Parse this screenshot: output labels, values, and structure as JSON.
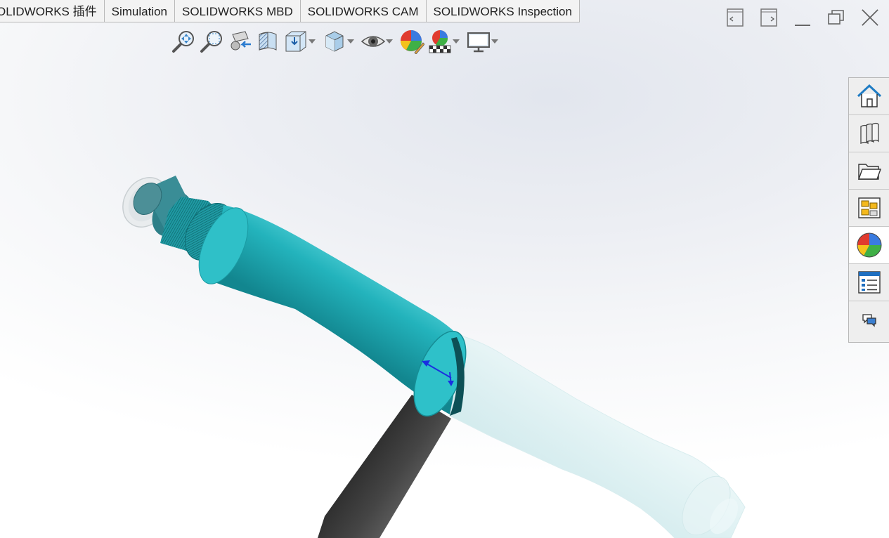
{
  "command_tabs": [
    {
      "label": "OLIDWORKS 插件"
    },
    {
      "label": "Simulation"
    },
    {
      "label": "SOLIDWORKS MBD"
    },
    {
      "label": "SOLIDWORKS CAM"
    },
    {
      "label": "SOLIDWORKS Inspection"
    }
  ],
  "window_controls": [
    "tile-left-icon",
    "tile-right-icon",
    "minimize-icon",
    "restore-icon",
    "close-icon"
  ],
  "view_toolbar": [
    "zoom-to-fit-icon",
    "zoom-to-area-icon",
    "previous-view-icon",
    "section-view-icon",
    "view-orientation-icon",
    "display-style-icon",
    "hide-show-items-icon",
    "edit-appearance-icon",
    "apply-scene-icon",
    "view-settings-icon"
  ],
  "task_pane": [
    {
      "icon": "home-icon"
    },
    {
      "icon": "design-library-icon"
    },
    {
      "icon": "file-explorer-icon"
    },
    {
      "icon": "view-palette-icon"
    },
    {
      "icon": "appearances-scenes-icon",
      "active": true
    },
    {
      "icon": "custom-properties-icon"
    },
    {
      "icon": "forum-icon"
    }
  ],
  "model": {
    "active_body_color": "#23b3bc",
    "transparent_body_color": "#d4eef0",
    "handle_color": "#3a3a3a",
    "triad_color": "#1a2fe0"
  }
}
